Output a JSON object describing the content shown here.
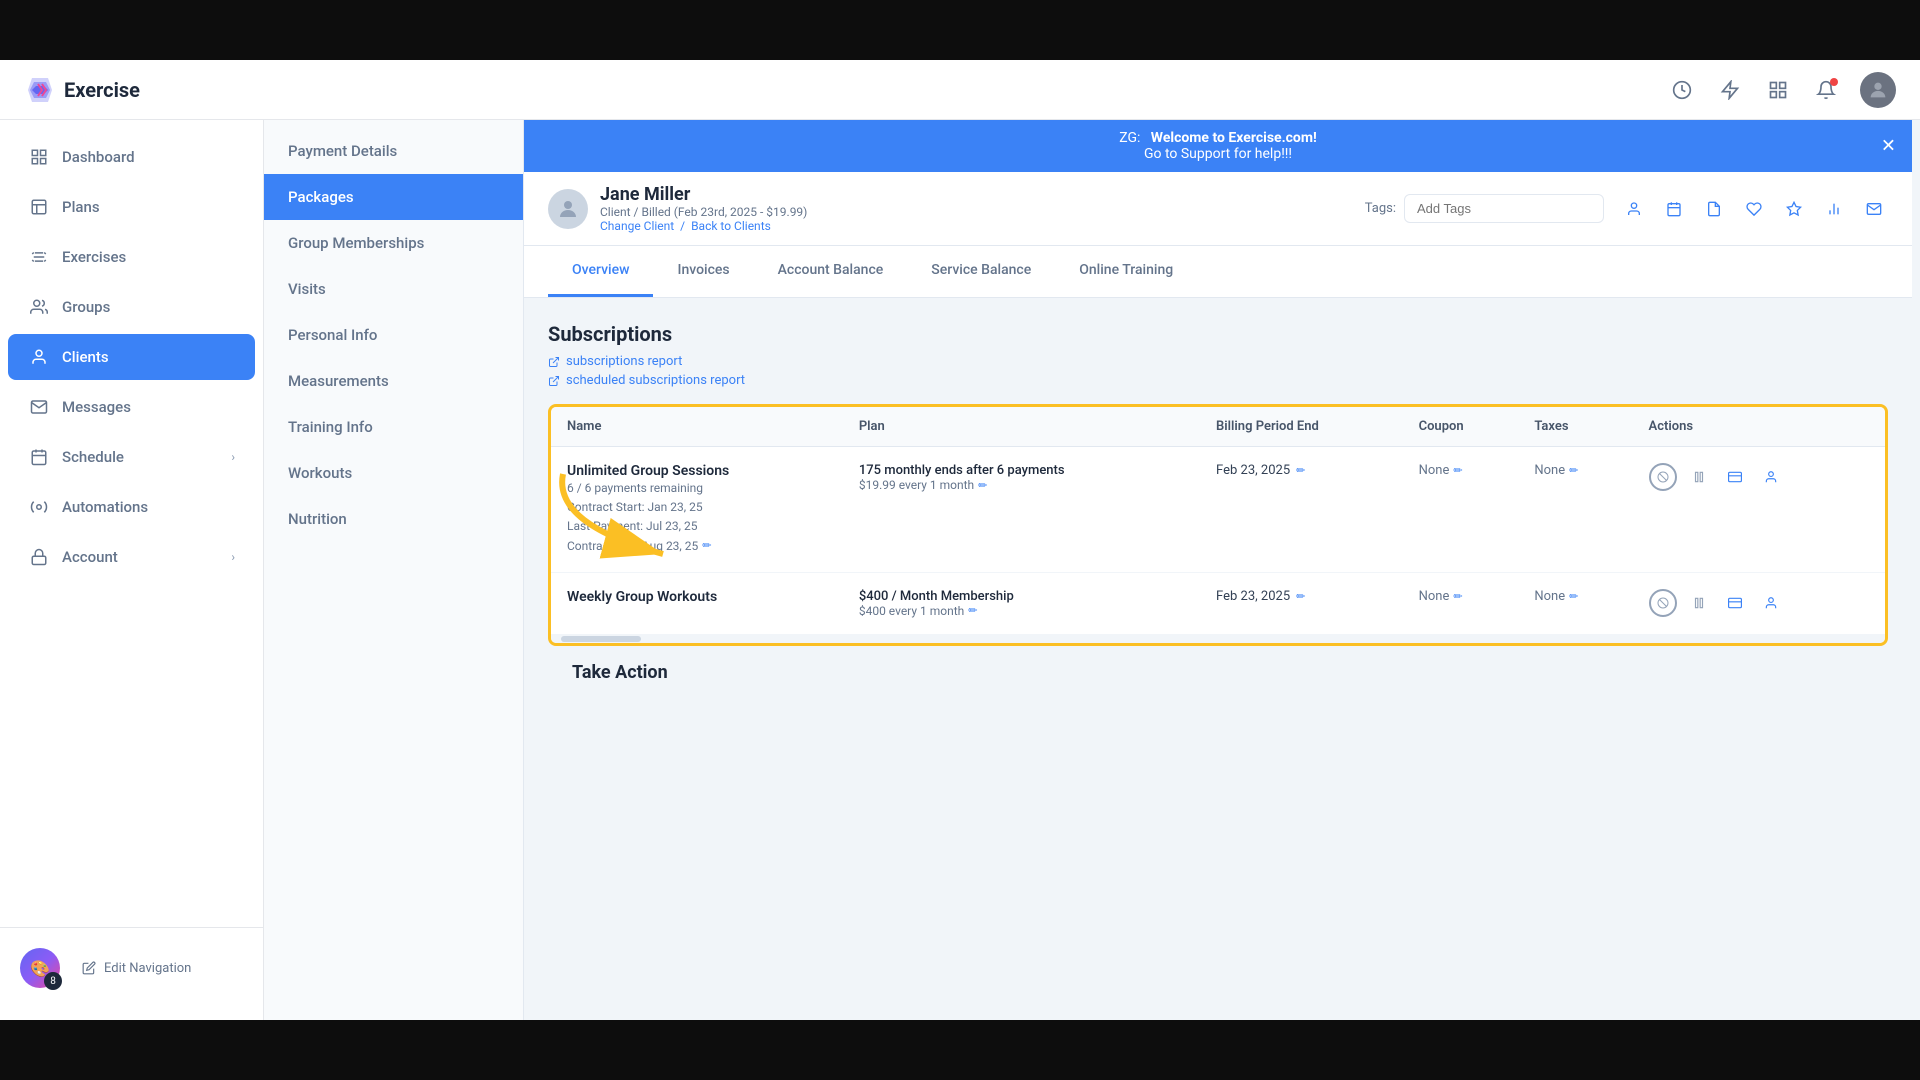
{
  "app": {
    "title": "Exercise",
    "logo_text": "Exercise"
  },
  "header": {
    "icons": [
      "clock",
      "bolt",
      "grid",
      "bell",
      "avatar"
    ],
    "notification_count": 1
  },
  "sidebar": {
    "items": [
      {
        "id": "dashboard",
        "label": "Dashboard",
        "icon": "⌂"
      },
      {
        "id": "plans",
        "label": "Plans",
        "icon": "📋"
      },
      {
        "id": "exercises",
        "label": "Exercises",
        "icon": "💪"
      },
      {
        "id": "groups",
        "label": "Groups",
        "icon": "👥"
      },
      {
        "id": "clients",
        "label": "Clients",
        "icon": "👤",
        "active": true
      },
      {
        "id": "messages",
        "label": "Messages",
        "icon": "✉"
      },
      {
        "id": "schedule",
        "label": "Schedule",
        "icon": "📅",
        "has_arrow": true
      },
      {
        "id": "automations",
        "label": "Automations",
        "icon": "⚙"
      },
      {
        "id": "account",
        "label": "Account",
        "icon": "🔒",
        "has_arrow": true
      }
    ],
    "edit_nav": "Edit Navigation",
    "badge_count": "8"
  },
  "client_nav": {
    "items": [
      {
        "id": "payment_details",
        "label": "Payment Details"
      },
      {
        "id": "packages",
        "label": "Packages",
        "active": true
      },
      {
        "id": "group_memberships",
        "label": "Group Memberships"
      },
      {
        "id": "visits",
        "label": "Visits"
      },
      {
        "id": "personal_info",
        "label": "Personal Info"
      },
      {
        "id": "measurements",
        "label": "Measurements"
      },
      {
        "id": "training_info",
        "label": "Training Info"
      },
      {
        "id": "workouts",
        "label": "Workouts"
      },
      {
        "id": "nutrition",
        "label": "Nutrition"
      }
    ]
  },
  "announcement": {
    "prefix": "ZG:",
    "bold_text": "Welcome to Exercise.com!",
    "suffix": "Go to Support for help!!!"
  },
  "client": {
    "name": "Jane Miller",
    "meta": "Client / Billed (Feb 23rd, 2025 - $19.99)",
    "change_link": "Change Client",
    "back_link": "Back to Clients",
    "tags_label": "Tags:",
    "tags_placeholder": "Add Tags"
  },
  "header_action_icons": [
    "person",
    "calendar",
    "document",
    "heart",
    "star",
    "chart",
    "email"
  ],
  "tabs": [
    {
      "id": "overview",
      "label": "Overview",
      "active": true
    },
    {
      "id": "invoices",
      "label": "Invoices"
    },
    {
      "id": "account_balance",
      "label": "Account Balance"
    },
    {
      "id": "service_balance",
      "label": "Service Balance"
    },
    {
      "id": "online_training",
      "label": "Online Training"
    }
  ],
  "subscriptions": {
    "title": "Subscriptions",
    "report_link": "subscriptions report",
    "scheduled_report_link": "scheduled subscriptions report",
    "table": {
      "columns": [
        "Name",
        "Plan",
        "Billing Period End",
        "Coupon",
        "Taxes",
        "Actions"
      ],
      "rows": [
        {
          "name": "Unlimited Group Sessions",
          "meta_line1": "6 / 6 payments remaining",
          "meta_line2": "Contract Start: Jan 23, 25",
          "meta_line3": "Last Payment: Jul 23, 25",
          "meta_line4": "Contract End: Aug 23, 25",
          "plan": "175 monthly ends after 6 payments",
          "plan_price": "$19.99 every 1 month",
          "billing_period_end": "Feb 23, 2025",
          "coupon": "None",
          "taxes": "None",
          "has_edit_icons": true
        },
        {
          "name": "Weekly Group Workouts",
          "meta_line1": "",
          "meta_line2": "",
          "meta_line3": "",
          "meta_line4": "",
          "plan": "$400 / Month Membership",
          "plan_price": "$400 every 1 month",
          "billing_period_end": "Feb 23, 2025",
          "coupon": "None",
          "taxes": "None",
          "has_edit_icons": true
        }
      ]
    }
  },
  "take_action": {
    "title": "Take Action"
  }
}
